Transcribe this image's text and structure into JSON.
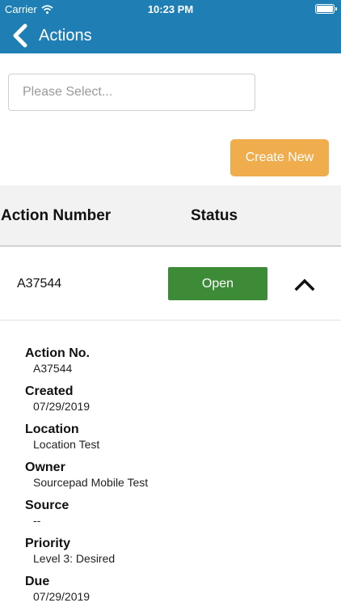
{
  "status_bar": {
    "carrier": "Carrier",
    "time": "10:23 PM"
  },
  "nav": {
    "title": "Actions"
  },
  "filter": {
    "placeholder": "Please Select..."
  },
  "toolbar": {
    "create_label": "Create New"
  },
  "table": {
    "headers": {
      "number": "Action Number",
      "status": "Status"
    },
    "rows": [
      {
        "number": "A37544",
        "status": "Open"
      }
    ]
  },
  "details": [
    {
      "label": "Action No.",
      "value": "A37544"
    },
    {
      "label": "Created",
      "value": "07/29/2019"
    },
    {
      "label": "Location",
      "value": "Location Test"
    },
    {
      "label": "Owner",
      "value": "Sourcepad Mobile Test"
    },
    {
      "label": "Source",
      "value": "--"
    },
    {
      "label": "Priority",
      "value": "Level 3: Desired"
    },
    {
      "label": "Due",
      "value": "07/29/2019"
    }
  ],
  "colors": {
    "brand": "#1f7fb4",
    "create_button": "#f0ad4e",
    "status_open": "#3d8b37"
  },
  "icons": {
    "back": "chevron-left-icon",
    "collapse": "chevron-up-icon",
    "wifi": "wifi-icon",
    "battery": "battery-icon"
  }
}
